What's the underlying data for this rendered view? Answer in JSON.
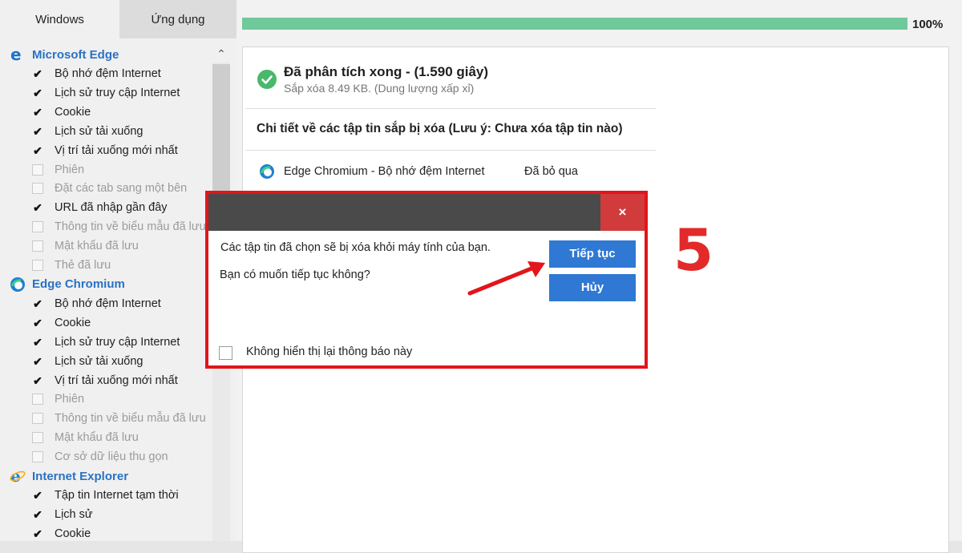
{
  "tabs": {
    "windows": "Windows",
    "apps": "Ứng dụng"
  },
  "tree": {
    "groups": [
      {
        "label": "Microsoft Edge",
        "icon": "edge-legacy-icon",
        "items": [
          {
            "label": "Bộ nhớ đệm Internet",
            "checked": true
          },
          {
            "label": "Lịch sử truy cập Internet",
            "checked": true
          },
          {
            "label": "Cookie",
            "checked": true
          },
          {
            "label": "Lịch sử tải xuống",
            "checked": true
          },
          {
            "label": "Vị trí tải xuống mới nhất",
            "checked": true
          },
          {
            "label": "Phiên",
            "checked": false
          },
          {
            "label": "Đặt các tab sang một bên",
            "checked": false
          },
          {
            "label": "URL đã nhập gần đây",
            "checked": true
          },
          {
            "label": "Thông tin về biểu mẫu đã lưu",
            "checked": false
          },
          {
            "label": "Mật khẩu đã lưu",
            "checked": false
          },
          {
            "label": "Thẻ đã lưu",
            "checked": false
          }
        ]
      },
      {
        "label": "Edge Chromium",
        "icon": "edge-chromium-icon",
        "items": [
          {
            "label": "Bộ nhớ đệm Internet",
            "checked": true
          },
          {
            "label": "Cookie",
            "checked": true
          },
          {
            "label": "Lịch sử truy cập Internet",
            "checked": true
          },
          {
            "label": "Lịch sử tải xuống",
            "checked": true
          },
          {
            "label": "Vị trí tải xuống mới nhất",
            "checked": true
          },
          {
            "label": "Phiên",
            "checked": false
          },
          {
            "label": "Thông tin về biểu mẫu đã lưu",
            "checked": false
          },
          {
            "label": "Mật khẩu đã lưu",
            "checked": false
          },
          {
            "label": "Cơ sở dữ liệu thu gọn",
            "checked": false
          }
        ]
      },
      {
        "label": "Internet Explorer",
        "icon": "internet-explorer-icon",
        "items": [
          {
            "label": "Tập tin Internet tạm thời",
            "checked": true
          },
          {
            "label": "Lịch sử",
            "checked": true
          },
          {
            "label": "Cookie",
            "checked": true
          }
        ]
      }
    ]
  },
  "progress": {
    "percent_label": "100%",
    "fraction": 1.0,
    "color": "#6fc99a"
  },
  "result": {
    "title": "Đã phân tích xong - (1.590 giây)",
    "subtitle": "Sắp xóa 8.49 KB. (Dung lượng xấp xỉ)",
    "details_header": "Chi tiết về các tập tin sắp bị xóa (Lưu ý: Chưa xóa tập tin nào)",
    "rows": [
      {
        "name": "Edge Chromium - Bộ nhớ đệm Internet",
        "status": "Đã bỏ qua"
      }
    ]
  },
  "dialog": {
    "close": "×",
    "message1": "Các tập tin đã chọn sẽ bị xóa khỏi máy tính của bạn.",
    "message2": "Bạn có muốn tiếp tục không?",
    "continue_label": "Tiếp tục",
    "cancel_label": "Hủy",
    "dont_show_label": "Không hiển thị lại thông báo này",
    "highlight_color": "#e3141b"
  },
  "annotation": {
    "step": "5",
    "color": "#e22a2a"
  }
}
